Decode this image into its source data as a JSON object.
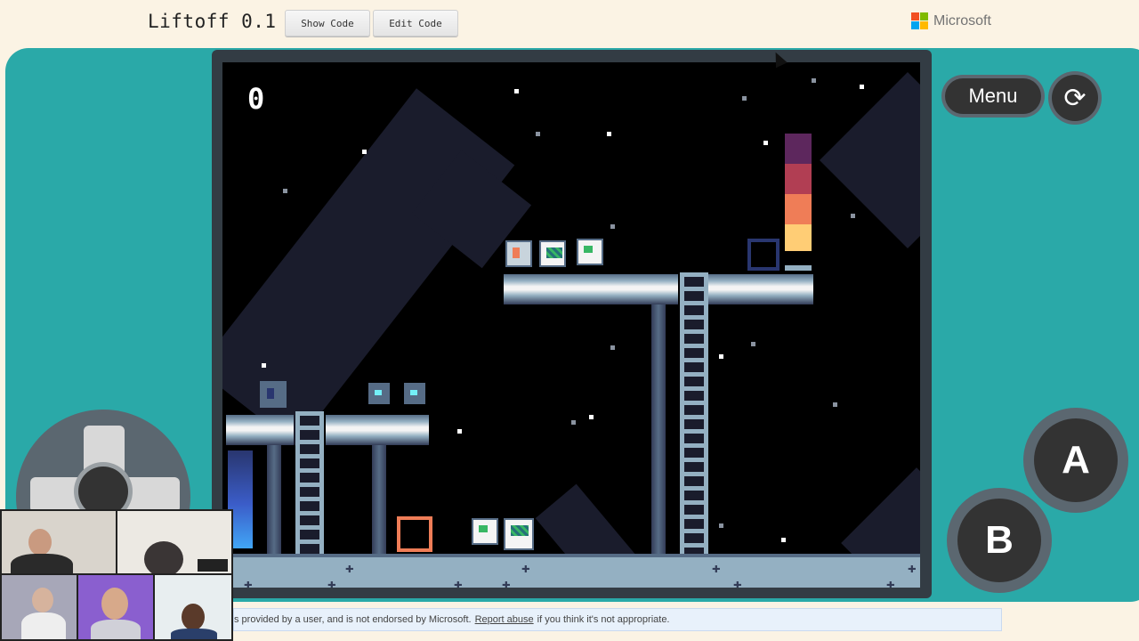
{
  "app": {
    "title": "Liftoff 0.1",
    "show_code_label": "Show Code",
    "edit_code_label": "Edit Code",
    "brand": "Microsoft"
  },
  "game": {
    "score": "0",
    "menu_label": "Menu",
    "a_label": "A",
    "b_label": "B",
    "refresh_icon": "refresh-icon",
    "colors": {
      "console": "#2aa9a8",
      "frame": "#333c44",
      "sky": "#000000",
      "shape": "#1a1c2c",
      "rocket": [
        "#5d275d",
        "#b13e53",
        "#ef7d57",
        "#ffcd75"
      ],
      "crate": "#ef7d57",
      "goal_outline": "#29366f"
    }
  },
  "footer": {
    "notice_prefix": "s provided by a user, and is not endorsed by Microsoft.",
    "report_link": "Report abuse",
    "notice_suffix": "if you think it's not appropriate."
  }
}
